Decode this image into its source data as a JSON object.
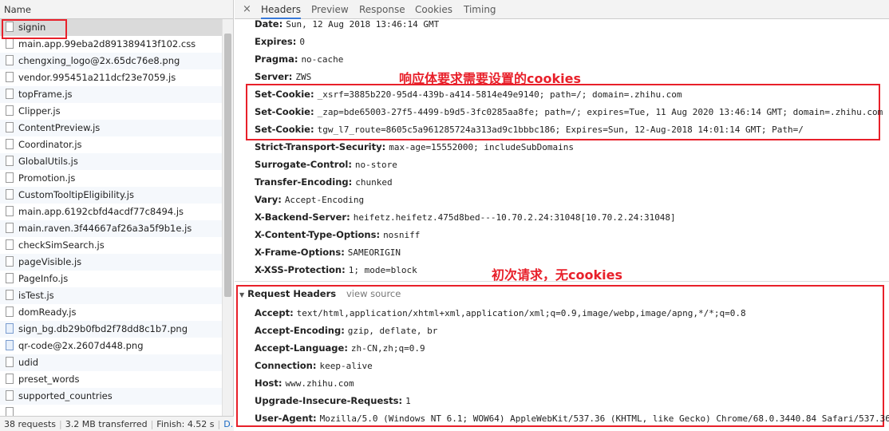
{
  "left_panel": {
    "header": "Name",
    "files": [
      {
        "name": "signin",
        "type": "doc"
      },
      {
        "name": "main.app.99eba2d891389413f102.css",
        "type": "doc"
      },
      {
        "name": "chengxing_logo@2x.65dc76e8.png",
        "type": "doc"
      },
      {
        "name": "vendor.995451a211dcf23e7059.js",
        "type": "doc"
      },
      {
        "name": "topFrame.js",
        "type": "doc"
      },
      {
        "name": "Clipper.js",
        "type": "doc"
      },
      {
        "name": "ContentPreview.js",
        "type": "doc"
      },
      {
        "name": "Coordinator.js",
        "type": "doc"
      },
      {
        "name": "GlobalUtils.js",
        "type": "doc"
      },
      {
        "name": "Promotion.js",
        "type": "doc"
      },
      {
        "name": "CustomTooltipEligibility.js",
        "type": "doc"
      },
      {
        "name": "main.app.6192cbfd4acdf77c8494.js",
        "type": "doc"
      },
      {
        "name": "main.raven.3f44667af26a3a5f9b1e.js",
        "type": "doc"
      },
      {
        "name": "checkSimSearch.js",
        "type": "doc"
      },
      {
        "name": "pageVisible.js",
        "type": "doc"
      },
      {
        "name": "PageInfo.js",
        "type": "doc"
      },
      {
        "name": "isTest.js",
        "type": "doc"
      },
      {
        "name": "domReady.js",
        "type": "doc"
      },
      {
        "name": "sign_bg.db29b0fbd2f78dd8c1b7.png",
        "type": "img"
      },
      {
        "name": "qr-code@2x.2607d448.png",
        "type": "img"
      },
      {
        "name": "udid",
        "type": "doc"
      },
      {
        "name": "preset_words",
        "type": "doc"
      },
      {
        "name": "supported_countries",
        "type": "doc"
      },
      {
        "name": "",
        "type": "doc"
      }
    ],
    "footer": {
      "requests": "38 requests",
      "transferred": "3.2 MB transferred",
      "finish": "Finish: 4.52 s",
      "dom": "D..."
    }
  },
  "tabs": {
    "close": "×",
    "items": [
      "Headers",
      "Preview",
      "Response",
      "Cookies",
      "Timing"
    ]
  },
  "response_headers": [
    {
      "key": "Date:",
      "value": "Sun, 12 Aug 2018 13:46:14 GMT"
    },
    {
      "key": "Expires:",
      "value": "0"
    },
    {
      "key": "Pragma:",
      "value": "no-cache"
    },
    {
      "key": "Server:",
      "value": "ZWS"
    },
    {
      "key": "Set-Cookie:",
      "value": "_xsrf=3885b220-95d4-439b-a414-5814e49e9140; path=/; domain=.zhihu.com"
    },
    {
      "key": "Set-Cookie:",
      "value": "_zap=bde65003-27f5-4499-b9d5-3fc0285aa8fe; path=/; expires=Tue, 11 Aug 2020 13:46:14 GMT; domain=.zhihu.com"
    },
    {
      "key": "Set-Cookie:",
      "value": "tgw_l7_route=8605c5a961285724a313ad9c1bbbc186; Expires=Sun, 12-Aug-2018 14:01:14 GMT; Path=/"
    },
    {
      "key": "Strict-Transport-Security:",
      "value": "max-age=15552000; includeSubDomains"
    },
    {
      "key": "Surrogate-Control:",
      "value": "no-store"
    },
    {
      "key": "Transfer-Encoding:",
      "value": "chunked"
    },
    {
      "key": "Vary:",
      "value": "Accept-Encoding"
    },
    {
      "key": "X-Backend-Server:",
      "value": "heifetz.heifetz.475d8bed---10.70.2.24:31048[10.70.2.24:31048]"
    },
    {
      "key": "X-Content-Type-Options:",
      "value": "nosniff"
    },
    {
      "key": "X-Frame-Options:",
      "value": "SAMEORIGIN"
    },
    {
      "key": "X-XSS-Protection:",
      "value": "1; mode=block"
    }
  ],
  "request_section": {
    "title": "Request Headers",
    "view_source": "view source"
  },
  "request_headers": [
    {
      "key": "Accept:",
      "value": "text/html,application/xhtml+xml,application/xml;q=0.9,image/webp,image/apng,*/*;q=0.8"
    },
    {
      "key": "Accept-Encoding:",
      "value": "gzip, deflate, br"
    },
    {
      "key": "Accept-Language:",
      "value": "zh-CN,zh;q=0.9"
    },
    {
      "key": "Connection:",
      "value": "keep-alive"
    },
    {
      "key": "Host:",
      "value": "www.zhihu.com"
    },
    {
      "key": "Upgrade-Insecure-Requests:",
      "value": "1"
    },
    {
      "key": "User-Agent:",
      "value": "Mozilla/5.0 (Windows NT 6.1; WOW64) AppleWebKit/537.36 (KHTML, like Gecko) Chrome/68.0.3440.84 Safari/537.36"
    }
  ],
  "annotations": {
    "response_note": "响应体要求需要设置的cookies",
    "request_note": "初次请求，无cookies"
  },
  "colors": {
    "annotation_red": "#e8202a",
    "tab_active": "#3879d9"
  }
}
